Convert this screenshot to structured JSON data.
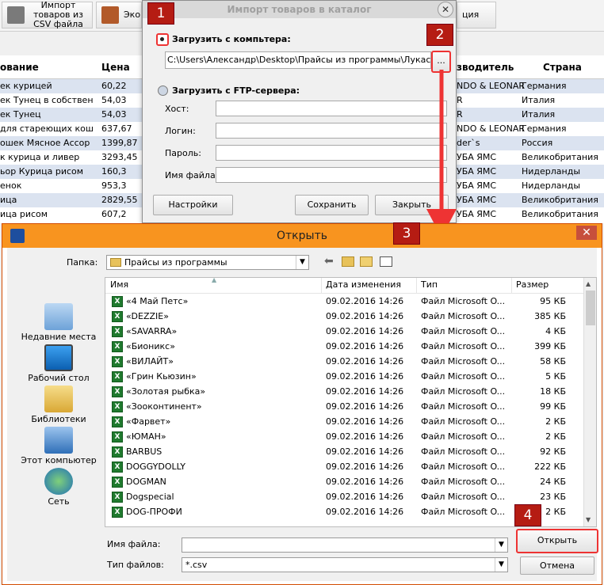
{
  "toolbar": {
    "import_csv": "Импорт товаров из CSV файла",
    "btn2": "Эко",
    "btn3": "ция"
  },
  "table": {
    "headers": [
      "ование",
      "Цена",
      "зводитель",
      "Страна"
    ],
    "rows": [
      [
        "ек курицей",
        "60,22",
        "NDO & LEONAR",
        "Германия"
      ],
      [
        "ек Тунец в собствен",
        "54,03",
        "R",
        "Италия"
      ],
      [
        "ек Тунец",
        "54,03",
        "R",
        "Италия"
      ],
      [
        "для стареющих кош",
        "637,67",
        "NDO & LEONAR",
        "Германия"
      ],
      [
        "ошек Мясное Ассор",
        "1399,87",
        "der`s",
        "Россия"
      ],
      [
        "к курица и ливер",
        "3293,45",
        "УБА ЯМС",
        "Великобритания"
      ],
      [
        "ьор Курица рисом",
        "160,3",
        "УБА ЯМС",
        "Нидерланды"
      ],
      [
        "енок",
        "953,3",
        "УБА ЯМС",
        "Нидерланды"
      ],
      [
        "ица",
        "2829,55",
        "УБА ЯМС",
        "Великобритания"
      ],
      [
        "ица рисом",
        "607,2",
        "УБА ЯМС",
        "Великобритания"
      ]
    ]
  },
  "import_dialog": {
    "title": "Импорт товаров в каталог",
    "from_pc_label": "Загрузить с компьтера:",
    "file_path": "C:\\Users\\Александр\\Desktop\\Прайсы из программы\\Лукас-Н.csv",
    "browse_label": "...",
    "from_ftp_label": "Загрузить с FTP-сервера:",
    "host_label": "Хост:",
    "login_label": "Логин:",
    "password_label": "Пароль:",
    "filename_label": "Имя файла:",
    "settings_button": "Настройки",
    "save_button": "Сохранить",
    "close_button": "Закрыть"
  },
  "badges": [
    "1",
    "2",
    "3",
    "4"
  ],
  "open_dialog": {
    "title": "Открыть",
    "folder_label": "Папка:",
    "folder_value": "Прайсы из программы",
    "places": [
      "Недавние места",
      "Рабочий стол",
      "Библиотеки",
      "Этот компьютер",
      "Сеть"
    ],
    "columns": [
      "Имя",
      "Дата изменения",
      "Тип",
      "Размер"
    ],
    "files": [
      {
        "name": "«4 Май Петс»",
        "date": "09.02.2016 14:26",
        "type": "Файл Microsoft O...",
        "size": "95 КБ"
      },
      {
        "name": "«DEZZIE»",
        "date": "09.02.2016 14:26",
        "type": "Файл Microsoft O...",
        "size": "385 КБ"
      },
      {
        "name": "«SAVARRA»",
        "date": "09.02.2016 14:26",
        "type": "Файл Microsoft O...",
        "size": "4 КБ"
      },
      {
        "name": "«Бионикс»",
        "date": "09.02.2016 14:26",
        "type": "Файл Microsoft O...",
        "size": "399 КБ"
      },
      {
        "name": "«ВИЛАЙТ»",
        "date": "09.02.2016 14:26",
        "type": "Файл Microsoft O...",
        "size": "58 КБ"
      },
      {
        "name": "«Грин Кьюзин»",
        "date": "09.02.2016 14:26",
        "type": "Файл Microsoft O...",
        "size": "5 КБ"
      },
      {
        "name": "«Золотая рыбка»",
        "date": "09.02.2016 14:26",
        "type": "Файл Microsoft O...",
        "size": "18 КБ"
      },
      {
        "name": "«Зооконтинент»",
        "date": "09.02.2016 14:26",
        "type": "Файл Microsoft O...",
        "size": "99 КБ"
      },
      {
        "name": "«Фарвет»",
        "date": "09.02.2016 14:26",
        "type": "Файл Microsoft O...",
        "size": "2 КБ"
      },
      {
        "name": "«ЮМАН»",
        "date": "09.02.2016 14:26",
        "type": "Файл Microsoft O...",
        "size": "2 КБ"
      },
      {
        "name": "BARBUS",
        "date": "09.02.2016 14:26",
        "type": "Файл Microsoft O...",
        "size": "92 КБ"
      },
      {
        "name": "DOGGYDOLLY",
        "date": "09.02.2016 14:26",
        "type": "Файл Microsoft O...",
        "size": "222 КБ"
      },
      {
        "name": "DOGMAN",
        "date": "09.02.2016 14:26",
        "type": "Файл Microsoft O...",
        "size": "24 КБ"
      },
      {
        "name": "Dogspecial",
        "date": "09.02.2016 14:26",
        "type": "Файл Microsoft O...",
        "size": "23 КБ"
      },
      {
        "name": "DOG-ПРОФИ",
        "date": "09.02.2016 14:26",
        "type": "Файл Microsoft O...",
        "size": "2 КБ"
      }
    ],
    "filename_label": "Имя файла:",
    "filename_value": "",
    "filetype_label": "Тип файлов:",
    "filetype_value": "*.csv",
    "open_button": "Открыть",
    "cancel_button": "Отмена"
  },
  "colors": {
    "highlight": "#e33333",
    "badge": "#b51c13",
    "title_bar": "#f8941f",
    "row_alt": "#dbe3f0"
  }
}
